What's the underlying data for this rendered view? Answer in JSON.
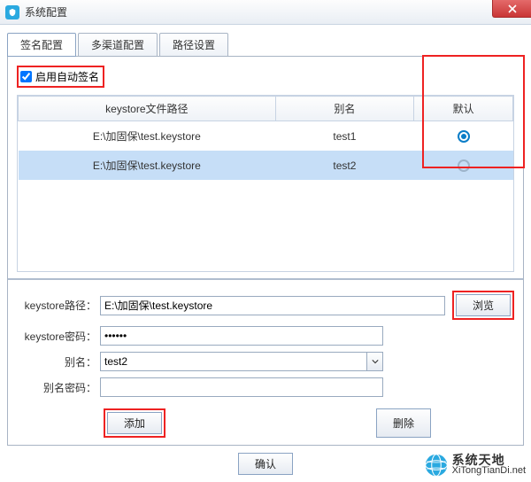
{
  "window": {
    "title": "系统配置"
  },
  "tabs": {
    "t0": "签名配置",
    "t1": "多渠道配置",
    "t2": "路径设置"
  },
  "checkbox": {
    "label": "启用自动签名",
    "checked": true
  },
  "table": {
    "headers": {
      "path": "keystore文件路径",
      "alias": "别名",
      "default": "默认"
    },
    "rows": [
      {
        "path": "E:\\加固保\\test.keystore",
        "alias": "test1",
        "default": true
      },
      {
        "path": "E:\\加固保\\test.keystore",
        "alias": "test2",
        "default": false
      }
    ]
  },
  "form": {
    "path_label": "keystore路径：",
    "path_value": "E:\\加固保\\test.keystore",
    "browse": "浏览",
    "pwd_label": "keystore密码：",
    "pwd_value": "••••••",
    "alias_label": "别名：",
    "alias_value": "test2",
    "alias_pwd_label": "别名密码：",
    "alias_pwd_value": ""
  },
  "buttons": {
    "add": "添加",
    "delete": "删除",
    "ok": "确认"
  },
  "brand": {
    "name": "系统天地",
    "url": "XiTongTianDi.net"
  }
}
